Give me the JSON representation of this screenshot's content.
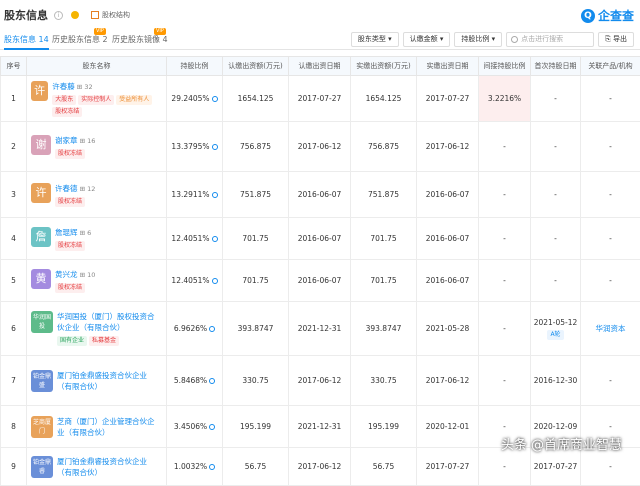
{
  "header": {
    "title": "股东信息",
    "structure_link": "股权结构",
    "logo": "企查查"
  },
  "tabs": [
    {
      "label": "股东信息",
      "count": "14"
    },
    {
      "label": "历史股东信息",
      "count": "2",
      "badge": "VIP"
    },
    {
      "label": "历史股东镜像",
      "count": "4",
      "badge": "VIP"
    }
  ],
  "filters": {
    "type": "股东类型",
    "amount": "认缴金额",
    "ratio": "持股比例",
    "search_placeholder": "点击进行搜索",
    "export": "导出"
  },
  "columns": [
    "序号",
    "股东名称",
    "持股比例",
    "认缴出资额(万元)",
    "认缴出资日期",
    "实缴出资额(万元)",
    "实缴出资日期",
    "间接持股比例",
    "首次持股日期",
    "关联产品/机构"
  ],
  "rows": [
    {
      "no": "1",
      "avatar": "许",
      "avatar_color": "#e8a25a",
      "name": "许春藤",
      "count": "32",
      "tags": [
        [
          "大股东",
          "red"
        ],
        [
          "实际控制人",
          "red"
        ],
        [
          "受益所有人",
          "org"
        ],
        [
          "股权冻结",
          "red"
        ]
      ],
      "ratio": "29.2405%",
      "sub_amt": "1654.125",
      "sub_date": "2017-07-27",
      "paid_amt": "1654.125",
      "paid_date": "2017-07-27",
      "indirect": "3.2216%",
      "first": "-",
      "product": "-"
    },
    {
      "no": "2",
      "avatar": "谢",
      "avatar_color": "#d9a2b8",
      "name": "谢家章",
      "count": "16",
      "tags": [
        [
          "股权冻结",
          "red"
        ]
      ],
      "ratio": "13.3795%",
      "sub_amt": "756.875",
      "sub_date": "2017-06-12",
      "paid_amt": "756.875",
      "paid_date": "2017-06-12",
      "indirect": "-",
      "first": "-",
      "product": "-"
    },
    {
      "no": "3",
      "avatar": "许",
      "avatar_color": "#e8a25a",
      "name": "许春德",
      "count": "12",
      "tags": [
        [
          "股权冻结",
          "red"
        ]
      ],
      "ratio": "13.2911%",
      "sub_amt": "751.875",
      "sub_date": "2016-06-07",
      "paid_amt": "751.875",
      "paid_date": "2016-06-07",
      "indirect": "-",
      "first": "-",
      "product": "-"
    },
    {
      "no": "4",
      "avatar": "詹",
      "avatar_color": "#6cc3c5",
      "name": "詹琨辉",
      "count": "6",
      "tags": [
        [
          "股权冻结",
          "red"
        ]
      ],
      "ratio": "12.4051%",
      "sub_amt": "701.75",
      "sub_date": "2016-06-07",
      "paid_amt": "701.75",
      "paid_date": "2016-06-07",
      "indirect": "-",
      "first": "-",
      "product": "-"
    },
    {
      "no": "5",
      "avatar": "黄",
      "avatar_color": "#a48be0",
      "name": "黄兴龙",
      "count": "10",
      "tags": [
        [
          "股权冻结",
          "red"
        ]
      ],
      "ratio": "12.4051%",
      "sub_amt": "701.75",
      "sub_date": "2016-06-07",
      "paid_amt": "701.75",
      "paid_date": "2016-06-07",
      "indirect": "-",
      "first": "-",
      "product": "-"
    },
    {
      "no": "6",
      "corp": "华润国投",
      "corp_color": "#5dbb8a",
      "name": "华润国投（厦门）股权投资合伙企业（有限合伙）",
      "tags": [
        [
          "国有企业",
          "green"
        ],
        [
          "私募基金",
          "red"
        ]
      ],
      "ratio": "6.9626%",
      "sub_amt": "393.8747",
      "sub_date": "2021-12-31",
      "paid_amt": "393.8747",
      "paid_date": "2021-05-28",
      "indirect": "-",
      "first": "2021-05-12",
      "first_tag": "A轮",
      "product": "华润资本"
    },
    {
      "no": "7",
      "corp": "铂金鼎盛",
      "corp_color": "#6a8fd8",
      "name": "厦门铂金鼎盛投资合伙企业（有限合伙）",
      "tags": [],
      "ratio": "5.8468%",
      "sub_amt": "330.75",
      "sub_date": "2017-06-12",
      "paid_amt": "330.75",
      "paid_date": "2017-06-12",
      "indirect": "-",
      "first": "2016-12-30",
      "product": "-"
    },
    {
      "no": "8",
      "corp": "芝商厦门",
      "corp_color": "#e8a25a",
      "name": "芝商（厦门）企业管理合伙企业（有限合伙）",
      "tags": [],
      "ratio": "3.4506%",
      "sub_amt": "195.199",
      "sub_date": "2021-12-31",
      "paid_amt": "195.199",
      "paid_date": "2020-12-01",
      "indirect": "-",
      "first": "2020-12-09",
      "product": "-"
    },
    {
      "no": "9",
      "corp": "铂金鼎睿",
      "corp_color": "#6a8fd8",
      "name": "厦门铂金鼎睿投资合伙企业（有限合伙）",
      "tags": [],
      "ratio": "1.0032%",
      "sub_amt": "56.75",
      "sub_date": "2017-06-12",
      "paid_amt": "56.75",
      "paid_date": "2017-07-27",
      "indirect": "-",
      "first": "2017-07-27",
      "product": "-"
    }
  ],
  "watermark": "头条 @首席商业智慧"
}
